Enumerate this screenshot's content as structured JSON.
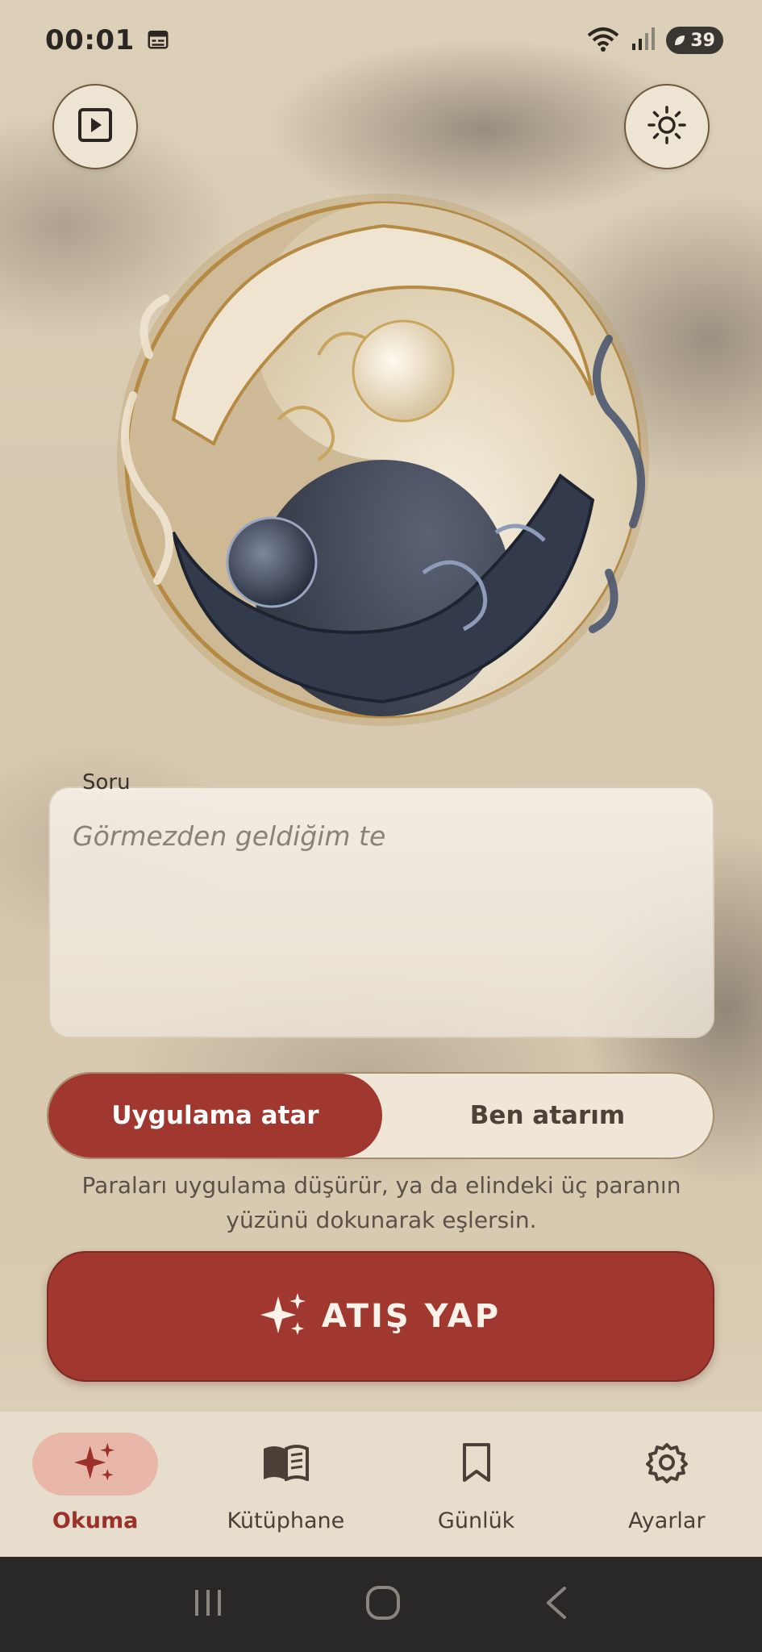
{
  "status_bar": {
    "time": "00:01",
    "battery": "39"
  },
  "icons": {
    "play": "play-square-icon",
    "theme": "sun-icon",
    "calendar": "calendar-icon",
    "wifi": "wifi-icon",
    "signal": "signal-icon"
  },
  "question": {
    "label": "Soru",
    "placeholder": "Görmezden geldiğim te"
  },
  "mode_toggle": {
    "options": [
      {
        "label": "Uygulama atar",
        "selected": true
      },
      {
        "label": "Ben atarım",
        "selected": false
      }
    ]
  },
  "helper_text": "Paraları uygulama düşürür, ya da elindeki üç paranın yüzünü dokunarak eşlersin.",
  "cta": {
    "label": "ATIŞ YAP",
    "icon": "sparkles-icon"
  },
  "bottom_nav": {
    "items": [
      {
        "label": "Okuma",
        "icon": "sparkles-icon",
        "active": true
      },
      {
        "label": "Kütüphane",
        "icon": "book-icon",
        "active": false
      },
      {
        "label": "Günlük",
        "icon": "bookmark-icon",
        "active": false
      },
      {
        "label": "Ayarlar",
        "icon": "gear-icon",
        "active": false
      }
    ]
  },
  "colors": {
    "accent": "#a1382f",
    "background": "#d8cab1",
    "nav_active_pill": "#e9b7aa"
  }
}
